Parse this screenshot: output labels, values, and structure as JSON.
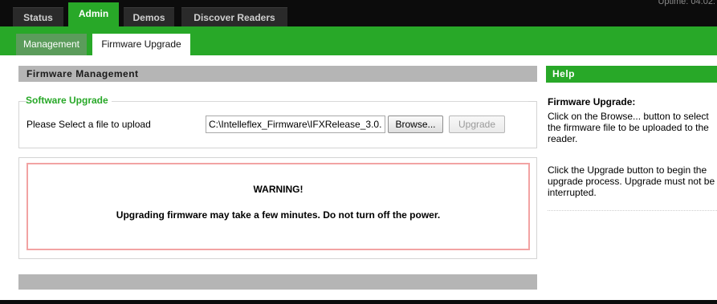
{
  "header": {
    "uptime": "Uptime: 04:02:",
    "tabs": [
      {
        "label": "Status"
      },
      {
        "label": "Admin"
      },
      {
        "label": "Demos"
      },
      {
        "label": "Discover Readers"
      }
    ],
    "active_tab": "Admin"
  },
  "subnav": {
    "tabs": [
      {
        "label": "Management"
      },
      {
        "label": "Firmware Upgrade"
      }
    ],
    "active_tab": "Firmware Upgrade"
  },
  "main": {
    "section_title": "Firmware Management",
    "software_upgrade": {
      "legend": "Software Upgrade",
      "label": "Please Select a file to upload",
      "file_path": "C:\\Intelleflex_Firmware\\IFXRelease_3.0.",
      "browse_label": "Browse...",
      "upgrade_label": "Upgrade"
    },
    "warning": {
      "title": "WARNING!",
      "text": "Upgrading firmware may take a few minutes. Do not turn off the power."
    }
  },
  "help": {
    "header": "Help",
    "title": "Firmware Upgrade:",
    "paragraph1": "Click on the Browse... button to select the firmware file to be uploaded to the reader.",
    "paragraph2": "Click the Upgrade button to begin the upgrade process. Upgrade must not be interrupted."
  },
  "colors": {
    "accent_green": "#28a828",
    "top_bar": "#0c0c0c",
    "section_gray": "#b5b5b5",
    "warning_border": "#f2a3a3"
  }
}
